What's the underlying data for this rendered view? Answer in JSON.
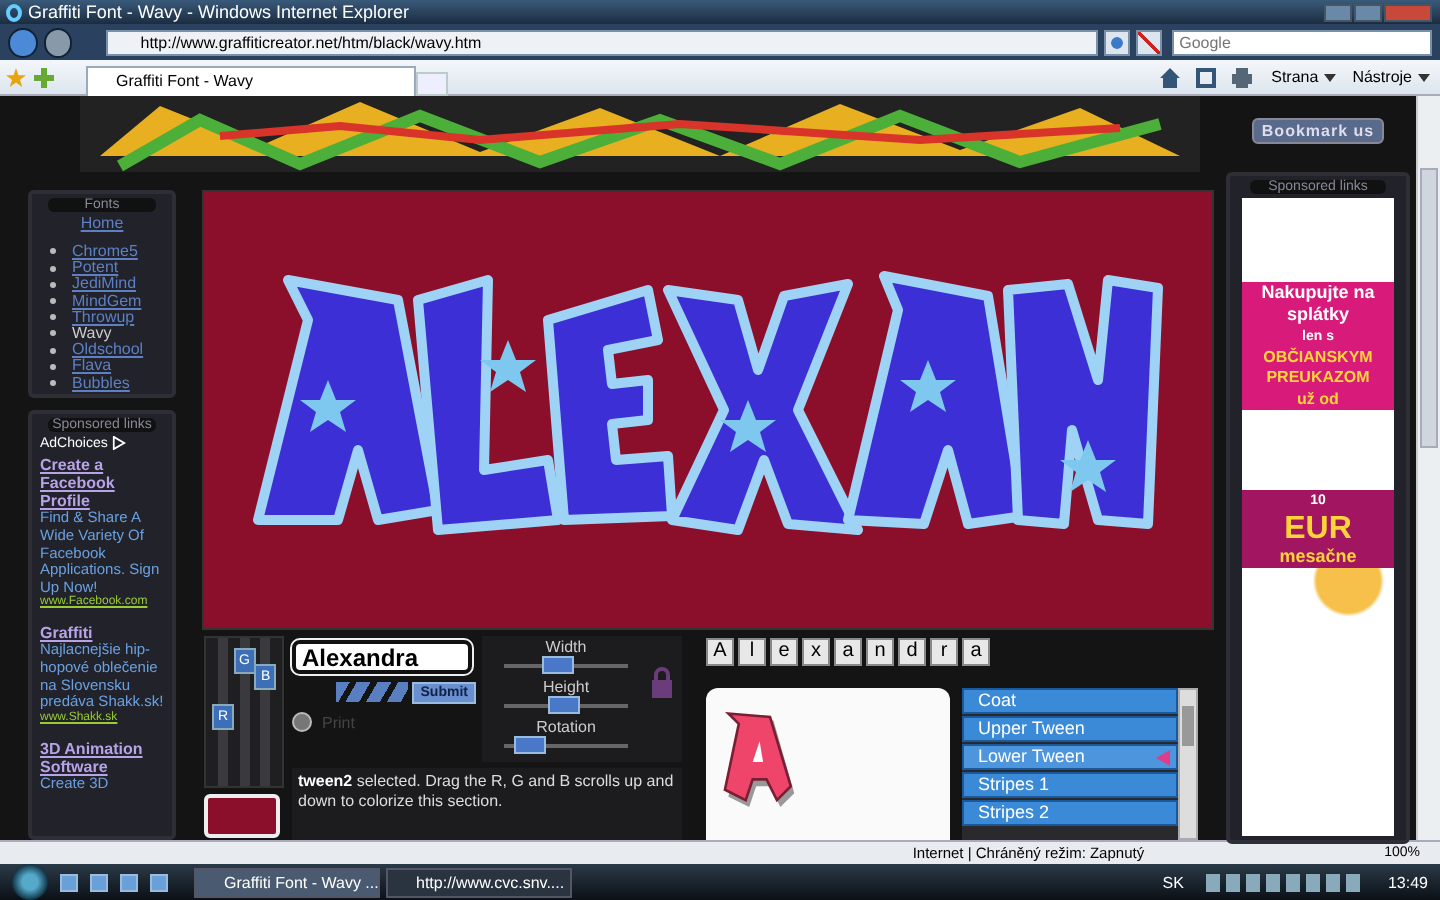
{
  "window": {
    "title": "Graffiti Font - Wavy - Windows Internet Explorer"
  },
  "address_bar": {
    "url": "http://www.graffiticreator.net/htm/black/wavy.htm"
  },
  "search": {
    "placeholder": "Google"
  },
  "tabs": [
    {
      "label": "Graffiti Font - Wavy",
      "selected": true
    }
  ],
  "command_bar": [
    "Strana",
    "Nástroje"
  ],
  "page": {
    "bookmark_button": "Bookmark us",
    "fonts_panel": {
      "heading": "Fonts",
      "home": "Home",
      "items": [
        {
          "label": "Chrome5",
          "selected": false
        },
        {
          "label": "Potent",
          "selected": false
        },
        {
          "label": "JediMind",
          "selected": false
        },
        {
          "label": "MindGem",
          "selected": false
        },
        {
          "label": "Throwup",
          "selected": false
        },
        {
          "label": "Wavy",
          "selected": true
        },
        {
          "label": "Oldschool",
          "selected": false
        },
        {
          "label": "Flava",
          "selected": false
        },
        {
          "label": "Bubbles",
          "selected": false
        }
      ]
    },
    "sponsored_left": {
      "heading": "Sponsored links",
      "adchoices": "AdChoices",
      "ads": [
        {
          "title": "Create a Facebook Profile",
          "text": "Find & Share A Wide Variety Of Facebook Applications. Sign Up Now!",
          "url": "www.Facebook.com"
        },
        {
          "title": "Graffiti",
          "text": "Najlacnejšie hip-hopové oblečenie na Slovensku predáva Shakk.sk!",
          "url": "www.Shakk.sk"
        },
        {
          "title": "3D Animation Software",
          "text": "Create 3D"
        }
      ]
    },
    "editor": {
      "channels": [
        {
          "label": "R",
          "level": 0.45
        },
        {
          "label": "G",
          "level": 0.9
        },
        {
          "label": "B",
          "level": 0.78
        }
      ],
      "swatch": {
        "color": "#8b0f2a"
      },
      "name_field": {
        "value": "Alexandra"
      },
      "submit": "Submit",
      "print": {
        "label": "Print",
        "checked": false
      },
      "sliders": [
        {
          "label": "Width",
          "level": 0.4
        },
        {
          "label": "Height",
          "level": 0.45
        },
        {
          "label": "Rotation",
          "level": 0.1
        }
      ],
      "message": "**tween2** selected. Drag the R, G and B scrolls up and down to colorize this section.",
      "letters": [
        "A",
        "l",
        "e",
        "x",
        "a",
        "n",
        "d",
        "r",
        "a"
      ],
      "layers": [
        {
          "label": "Coat",
          "selected": false
        },
        {
          "label": "Upper Tween",
          "selected": false
        },
        {
          "label": "Lower Tween",
          "selected": true
        },
        {
          "label": "Stripes 1",
          "selected": false
        },
        {
          "label": "Stripes 2",
          "selected": false
        }
      ]
    },
    "sponsored_right": {
      "heading": "Sponsored links",
      "ad_lines": [
        "Nakupujte na splátky",
        "len s",
        "OBČIANSKYM PREUKAZOM",
        "už od",
        "10",
        "EUR",
        "mesačne"
      ]
    }
  },
  "status_bar": {
    "zone": "Internet | Chráněný režim: Zapnutý",
    "zoom": "100%"
  },
  "taskbar": {
    "tasks": [
      {
        "label": "Graffiti Font - Wavy ...",
        "selected": true
      },
      {
        "label": "http://www.cvc.snv....",
        "selected": false
      }
    ],
    "language": "SK",
    "clock": "13:49"
  }
}
